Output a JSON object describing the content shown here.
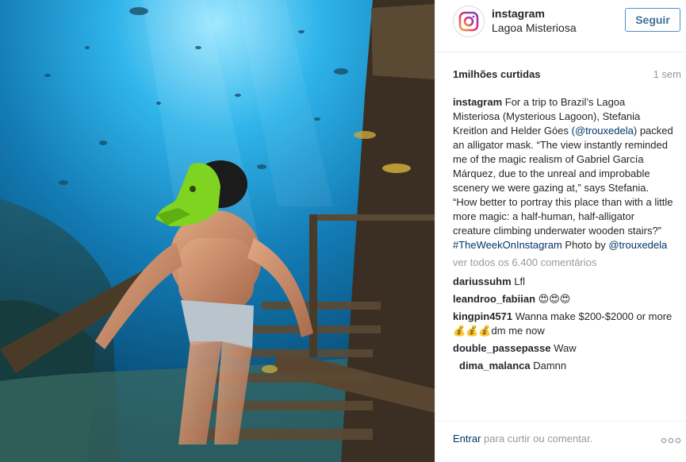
{
  "post": {
    "username": "instagram",
    "location": "Lagoa Misteriosa",
    "follow_label": "Seguir",
    "likes": "1milhões curtidas",
    "time": "1 sem"
  },
  "caption": {
    "username": "instagram",
    "text_1": "For a trip to Brazil’s Lagoa Misteriosa (Mysterious Lagoon), Stefania Kreitlon and Helder Góes",
    "mention_1": "(@trouxedela)",
    "text_2": "packed an alligator mask. “The view instantly reminded me of the magic realism of Gabriel García Márquez, due to the unreal and improbable scenery we were gazing at,” says Stefania. “How better to portray this place than with a little more magic: a half-human, half-alligator creature climbing underwater wooden stairs?”",
    "hashtag": "#TheWeekOnInstagram",
    "text_3": "Photo by",
    "mention_2": "@trouxedela"
  },
  "view_all": "ver todos os 6.400 comentários",
  "comments": [
    {
      "user": "dariussuhm",
      "text": "Lfl"
    },
    {
      "user": "leandroo_fabiian",
      "text": "😍😍😍"
    },
    {
      "user": "kingpin4571",
      "text": "Wanna make $200-$2000 or more 💰💰💰dm me now"
    },
    {
      "user": "double_passepasse",
      "text": "Waw"
    },
    {
      "user": "dima_malanca",
      "text": "Damnn"
    }
  ],
  "footer": {
    "link": "Entrar",
    "text": "para curtir ou comentar."
  },
  "icons": {
    "avatar": "instagram-logo-icon",
    "more": "more-options-icon"
  },
  "colors": {
    "follow_border": "#4f8fcd",
    "follow_text": "#3f729b",
    "link": "#003569",
    "muted": "#999999"
  }
}
